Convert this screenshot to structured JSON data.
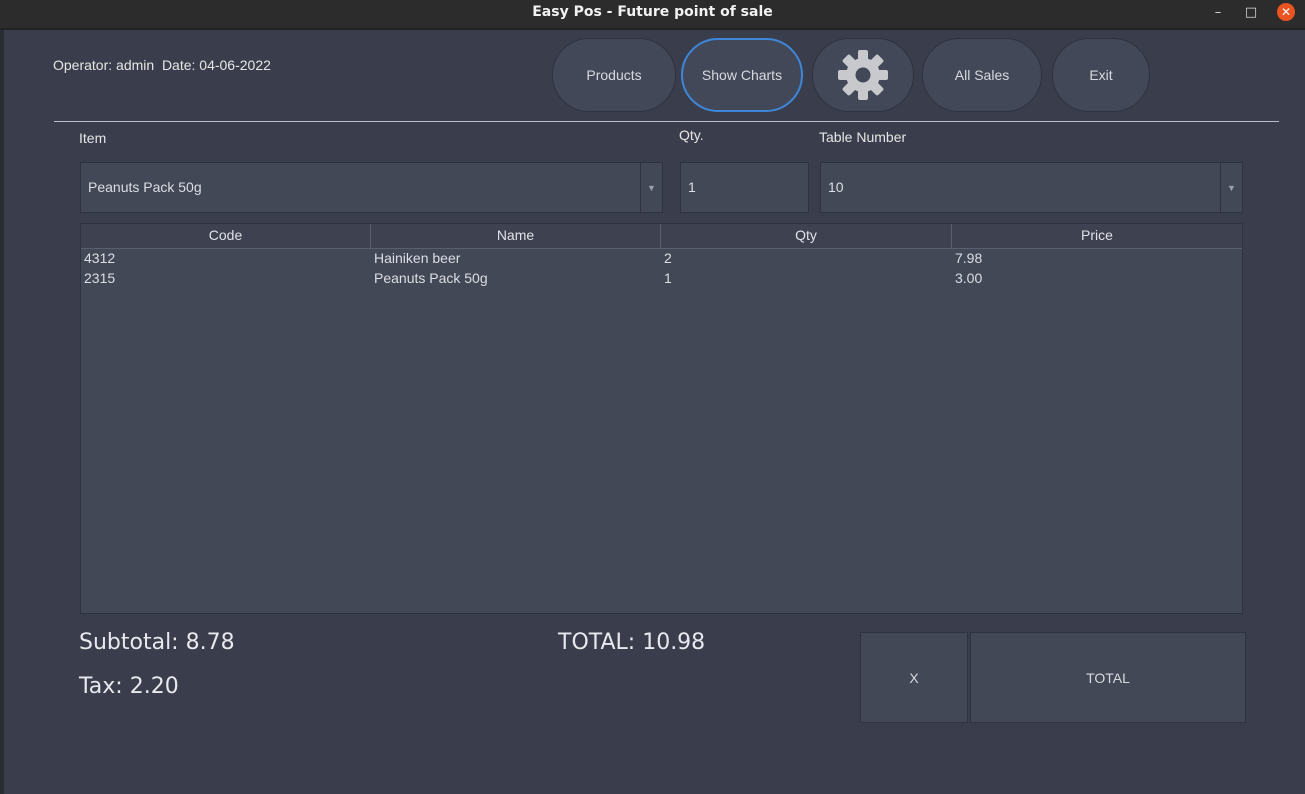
{
  "window": {
    "title": "Easy Pos - Future point of sale",
    "minimize_glyph": "–",
    "maximize_glyph": "□",
    "close_glyph": "✕"
  },
  "header": {
    "operator_text": "Operator: admin  Date: 04-06-2022"
  },
  "nav": {
    "products_label": "Products",
    "show_charts_label": "Show Charts",
    "settings_icon": "gear-icon",
    "all_sales_label": "All Sales",
    "exit_label": "Exit"
  },
  "form": {
    "item_label": "Item",
    "item_value": "Peanuts Pack 50g",
    "qty_label": "Qty.",
    "qty_value": "1",
    "table_label": "Table Number",
    "table_value": "10"
  },
  "order_table": {
    "columns": [
      "Code",
      "Name",
      "Qty",
      "Price"
    ],
    "rows": [
      {
        "code": "4312",
        "name": "Hainiken beer",
        "qty": "2",
        "price": "7.98"
      },
      {
        "code": "2315",
        "name": "Peanuts Pack 50g",
        "qty": "1",
        "price": "3.00"
      }
    ]
  },
  "summary": {
    "subtotal_text": "Subtotal: 8.78",
    "tax_text": "Tax: 2.20",
    "total_text": "TOTAL: 10.98"
  },
  "actions": {
    "clear_label": "X",
    "total_label": "TOTAL"
  },
  "colors": {
    "background": "#3a3e4c",
    "panel": "#434857",
    "focus_ring": "#3d86d8",
    "close_button": "#e95420"
  }
}
